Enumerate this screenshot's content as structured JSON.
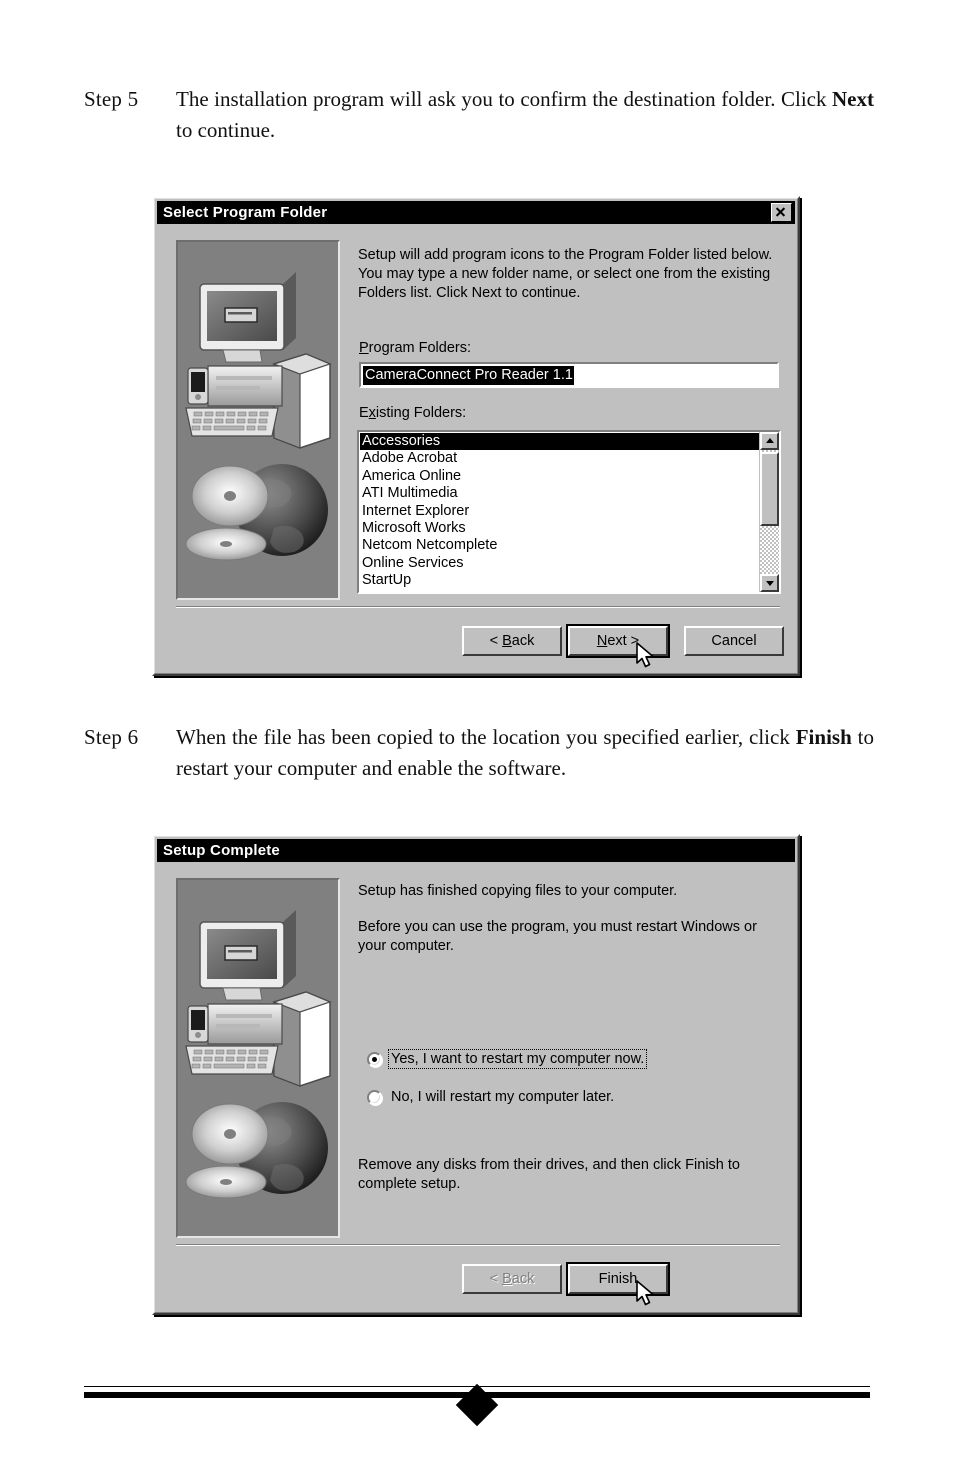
{
  "page": {
    "steps": [
      {
        "label": "Step 5",
        "text_html": "The installation program will ask you to confirm the destination folder. Click Next to continue.",
        "text_part1": "The installation program will ask you to confirm the destination folder. Click ",
        "bold_word": "Next",
        "text_part2": " to continue."
      },
      {
        "label": "Step 6",
        "text_part1": "When the file has been copied to the location you specified earlier, click ",
        "bold_word": "Finish",
        "text_part2": " to restart your computer and enable the software."
      }
    ],
    "footer": {
      "ornament": "diamond"
    }
  },
  "dialog1": {
    "title": "Select Program Folder",
    "close_icon": "close-x-icon",
    "graphic": "setup-computer-cd-globe-graphic",
    "intro_text": "Setup will add program icons to the Program Folder listed below.\nYou may type a new folder name, or select one from the existing\nFolders list.  Click Next to continue.",
    "program_folders_label": "Program Folders:",
    "program_folders_label_accel": "P",
    "program_folders_value": "CameraConnect Pro Reader 1.1",
    "existing_folders_label": "Existing Folders:",
    "existing_folders_label_accel": "x",
    "existing_folders": [
      "Accessories",
      "Adobe Acrobat",
      "America Online",
      "ATI Multimedia",
      "Internet Explorer",
      "Microsoft Works",
      "Netcom Netcomplete",
      "Online Services",
      "StartUp"
    ],
    "selected_folder_index": 0,
    "scrollbar": {
      "up_icon": "scroll-up-arrow-icon",
      "down_icon": "scroll-down-arrow-icon",
      "thumb_top_pct": 2,
      "thumb_height_pct": 64
    },
    "buttons": {
      "back": {
        "label": "< Back",
        "accel": "B",
        "disabled": false,
        "default": false
      },
      "next": {
        "label": "Next >",
        "accel": "N",
        "disabled": false,
        "default": true
      },
      "cancel": {
        "label": "Cancel",
        "accel": "",
        "disabled": false,
        "default": false
      }
    },
    "cursor_on": "next-button"
  },
  "dialog2": {
    "title": "Setup Complete",
    "graphic": "setup-computer-cd-globe-graphic",
    "paragraph1": "Setup has finished copying files to your computer.",
    "paragraph2": "Before you can use the program, you must restart Windows or\nyour computer.",
    "paragraph3": "Remove any disks from their drives, and then click Finish to\ncomplete setup.",
    "radios": [
      {
        "label": "Yes, I want to restart my computer now.",
        "selected": true,
        "focused": true
      },
      {
        "label": "No, I will restart my computer later.",
        "selected": false,
        "focused": false
      }
    ],
    "buttons": {
      "back": {
        "label": "< Back",
        "accel": "B",
        "disabled": true,
        "default": false
      },
      "finish": {
        "label": "Finish",
        "accel": "",
        "disabled": false,
        "default": true
      }
    },
    "cursor_on": "finish-button"
  },
  "colors": {
    "dialog_face": "#c0c0c0",
    "titlebar": "#000000",
    "titlebar_text": "#ffffff",
    "selection": "#000000",
    "graphic_bg": "#808080",
    "disabled_text": "#808080"
  }
}
